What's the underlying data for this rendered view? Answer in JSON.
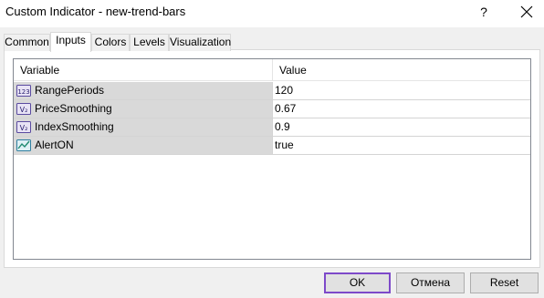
{
  "window": {
    "title": "Custom Indicator - new-trend-bars",
    "help_label": "?"
  },
  "tabs": [
    {
      "label": "Common",
      "active": false
    },
    {
      "label": "Inputs",
      "active": true
    },
    {
      "label": "Colors",
      "active": false
    },
    {
      "label": "Levels",
      "active": false
    },
    {
      "label": "Visualization",
      "active": false
    }
  ],
  "grid": {
    "columns": [
      "Variable",
      "Value"
    ],
    "rows": [
      {
        "icon": "integer-icon",
        "name": "RangePeriods",
        "value": "120"
      },
      {
        "icon": "double-value-icon",
        "name": "PriceSmoothing",
        "value": "0.67"
      },
      {
        "icon": "double-value-icon",
        "name": "IndexSmoothing",
        "value": "0.9"
      },
      {
        "icon": "boolean-chart-icon",
        "name": "AlertON",
        "value": "true"
      }
    ]
  },
  "buttons": {
    "ok": "OK",
    "cancel": "Отмена",
    "reset": "Reset"
  },
  "colors": {
    "default_button_border": "#7d49c9",
    "variable_cell_bg": "#d9d9d9"
  }
}
